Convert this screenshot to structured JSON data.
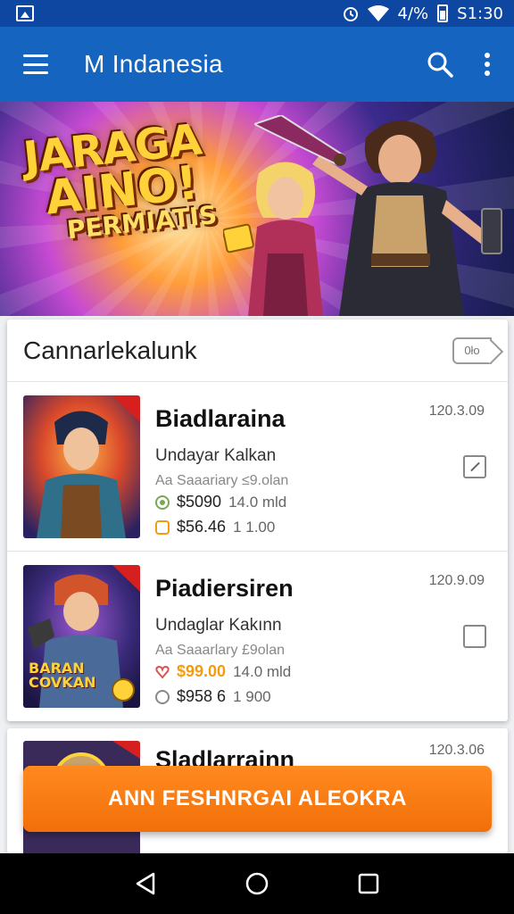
{
  "status_bar": {
    "signal_text": "4/%",
    "time": "S1:30"
  },
  "app_bar": {
    "title": "M Indanesia"
  },
  "banner": {
    "title_line1": "JARAGA",
    "title_line2": "AINO!",
    "title_line3": "PERMIATIS"
  },
  "list": {
    "header": "Cannarlekalunk",
    "badge": "0ło",
    "items": [
      {
        "title": "Biadlaraina",
        "date": "120.3.09",
        "subtitle": "Undayar Kalkan",
        "meta": "Aa Saaariary ≤9.olan",
        "price1": "$5090",
        "value1": "14.0 mld",
        "price2": "$56.46",
        "value2": "1 1.00",
        "checked": true
      },
      {
        "title": "Piadiersiren",
        "date": "120.9.09",
        "subtitle": "Undaglar Kakınn",
        "meta": "Aa Saaarlary £9olan",
        "price1": "$99.00",
        "value1": "14.0 mld",
        "price2": "$958 6",
        "value2": "1 900",
        "checked": false
      },
      {
        "title": "Sladlarrainn",
        "date": "120.3.06"
      }
    ]
  },
  "cta": {
    "label": "ANN FESHNRGAI ALEOKRA"
  },
  "thumb_texts": {
    "item2_line1": "BARAN",
    "item2_line2": "COVKAN"
  }
}
